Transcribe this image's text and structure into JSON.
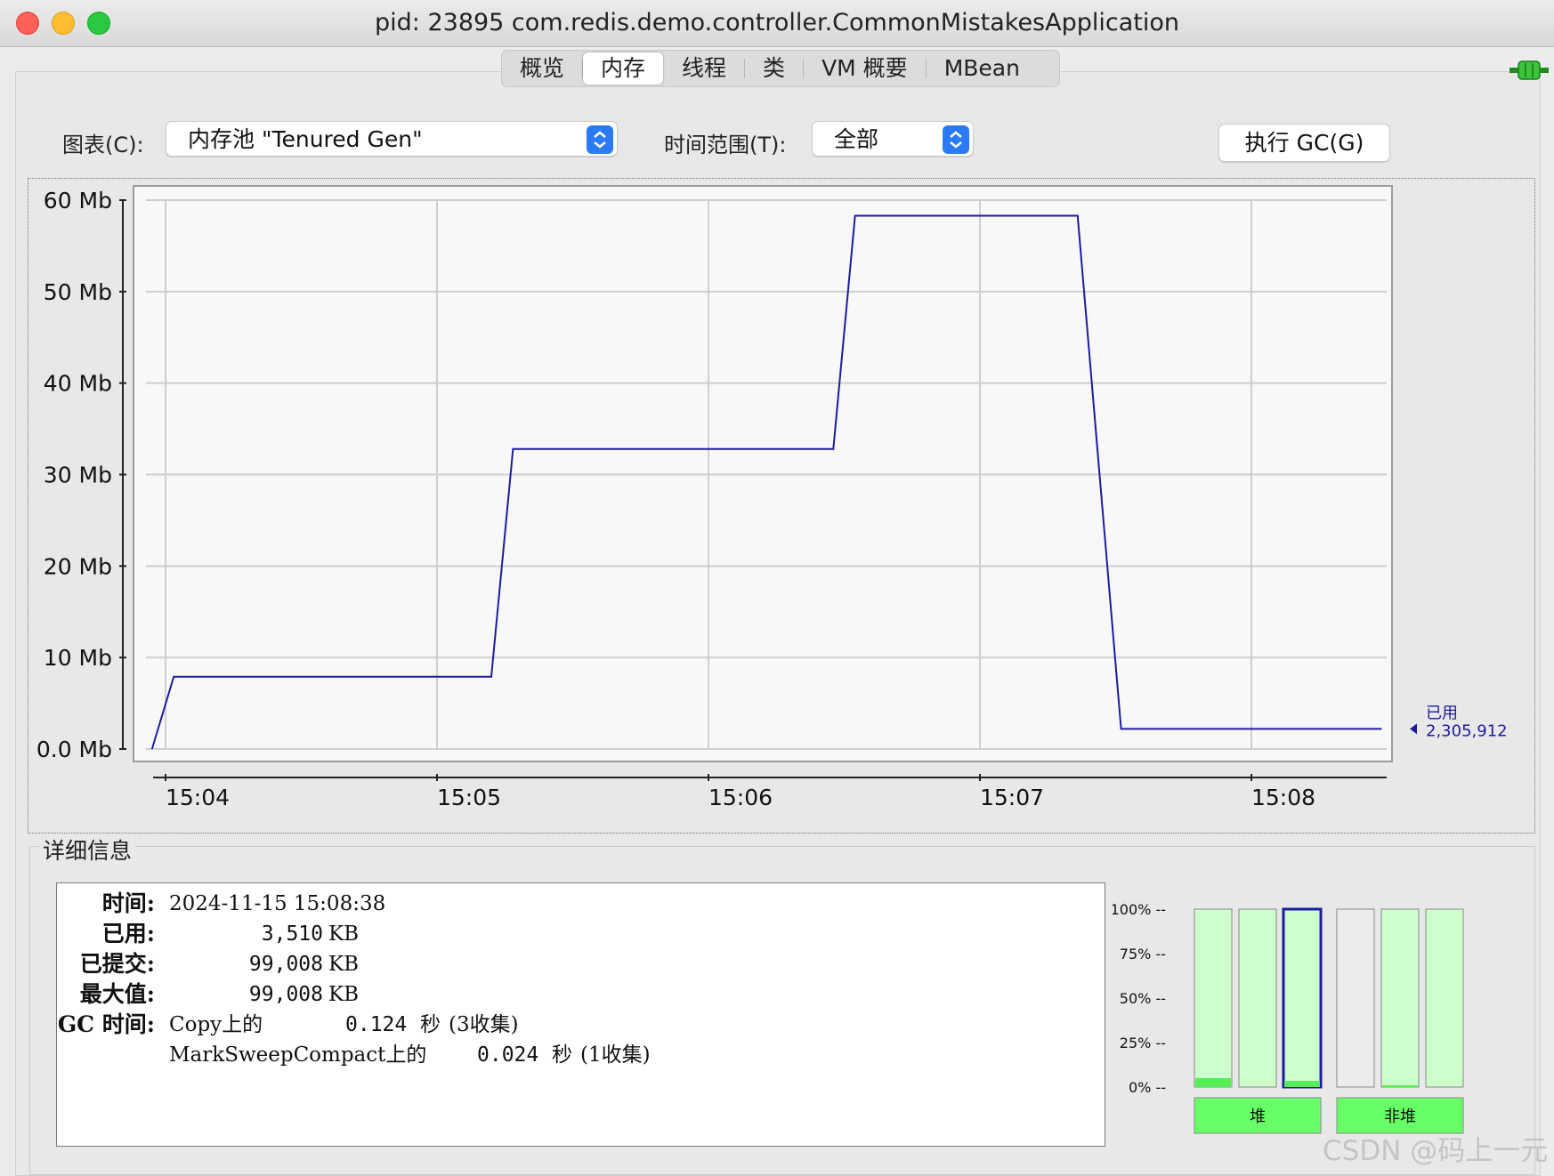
{
  "window": {
    "title": "pid: 23895 com.redis.demo.controller.CommonMistakesApplication"
  },
  "tabs": [
    {
      "label": "概览",
      "active": false
    },
    {
      "label": "内存",
      "active": true
    },
    {
      "label": "线程",
      "active": false
    },
    {
      "label": "类",
      "active": false
    },
    {
      "label": "VM 概要",
      "active": false
    },
    {
      "label": "MBean",
      "active": false
    }
  ],
  "controls": {
    "chart_label": "图表(C):",
    "chart_value": "内存池 \"Tenured Gen\"",
    "range_label": "时间范围(T):",
    "range_value": "全部",
    "gc_button": "执行 GC(G)"
  },
  "chart_data": {
    "type": "line",
    "ylim": [
      0,
      60
    ],
    "yticks": [
      "0.0 Mb",
      "10 Mb",
      "20 Mb",
      "30 Mb",
      "40 Mb",
      "50 Mb",
      "60 Mb"
    ],
    "xticks": [
      "15:04",
      "15:05",
      "15:06",
      "15:07",
      "15:08"
    ],
    "x_unit_minutes": [
      0,
      1,
      2,
      3,
      4
    ],
    "series": [
      {
        "name": "已用",
        "color": "#1c1ca0",
        "points": [
          [
            -0.05,
            0.0
          ],
          [
            0.03,
            7.9
          ],
          [
            1.2,
            7.9
          ],
          [
            1.28,
            32.8
          ],
          [
            2.46,
            32.8
          ],
          [
            2.54,
            58.3
          ],
          [
            3.36,
            58.3
          ],
          [
            3.52,
            2.2
          ],
          [
            4.48,
            2.2
          ]
        ]
      }
    ],
    "end_label": {
      "name": "已用",
      "value": "2,305,912"
    },
    "grid": true
  },
  "details": {
    "group_title": "详细信息",
    "rows": [
      {
        "key": "时间:",
        "value": "2024-11-15 15:08:38"
      },
      {
        "key": "已用:",
        "value": "3,510",
        "unit": "KB"
      },
      {
        "key": "已提交:",
        "value": "99,008",
        "unit": "KB"
      },
      {
        "key": "最大值:",
        "value": "99,008",
        "unit": "KB"
      },
      {
        "key": "GC 时间:",
        "gc": [
          {
            "name": "Copy上的",
            "time": "0.124",
            "unit": "秒",
            "note": "(3收集)"
          },
          {
            "name": "MarkSweepCompact上的",
            "time": "0.024",
            "unit": "秒",
            "note": "(1收集)"
          }
        ]
      }
    ]
  },
  "pool_bars": {
    "y_labels": [
      "100%",
      "75%",
      "50%",
      "25%",
      "0%"
    ],
    "heap": [
      0.05,
      0.0,
      0.035
    ],
    "nonheap": [
      0.0,
      0.01,
      0.0
    ],
    "heap_label": "堆",
    "nonheap_label": "非堆"
  },
  "watermark": "CSDN @码上一元"
}
